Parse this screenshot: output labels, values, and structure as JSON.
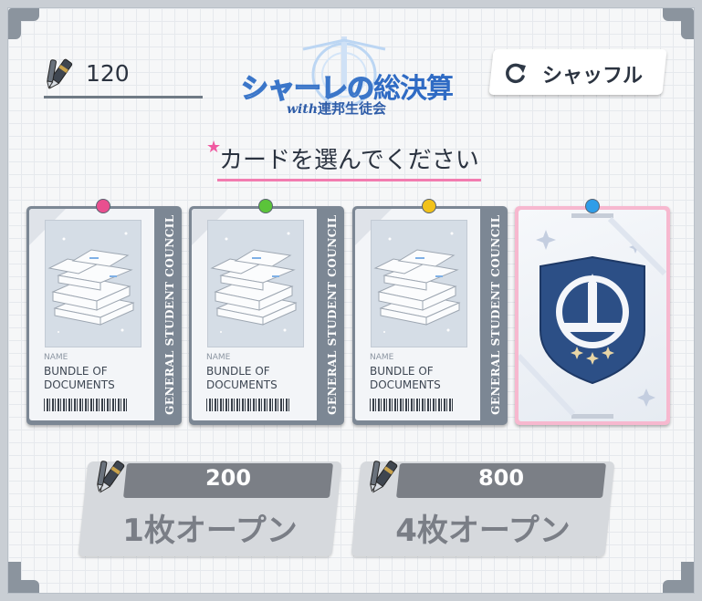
{
  "currency": {
    "icon": "pen-currency-icon",
    "amount": "120"
  },
  "logo": {
    "line1_a": "シャーレの",
    "line1_b": "総決算",
    "line2_with": "with",
    "line2_b": "連邦生徒会"
  },
  "shuffle": {
    "icon": "refresh-icon",
    "label": "シャッフル"
  },
  "instruction": {
    "text": "カードを選んでください"
  },
  "cards": [
    {
      "pin_color": "#e94f8f",
      "name_label": "NAME",
      "name": "BUNDLE OF DOCUMENTS",
      "side_text": "GENERAL STUDENT COUNCIL"
    },
    {
      "pin_color": "#5bc43a",
      "name_label": "NAME",
      "name": "BUNDLE OF DOCUMENTS",
      "side_text": "GENERAL STUDENT COUNCIL"
    },
    {
      "pin_color": "#f2c21a",
      "name_label": "NAME",
      "name": "BUNDLE OF DOCUMENTS",
      "side_text": "GENERAL STUDENT COUNCIL"
    },
    {
      "pin_color": "#2f9de8",
      "face": "back",
      "emblem": "tower-shield-emblem"
    }
  ],
  "buttons": [
    {
      "cost": "200",
      "label": "1枚オープン",
      "icon": "pen-currency-icon"
    },
    {
      "cost": "800",
      "label": "4枚オープン",
      "icon": "pen-currency-icon"
    }
  ]
}
